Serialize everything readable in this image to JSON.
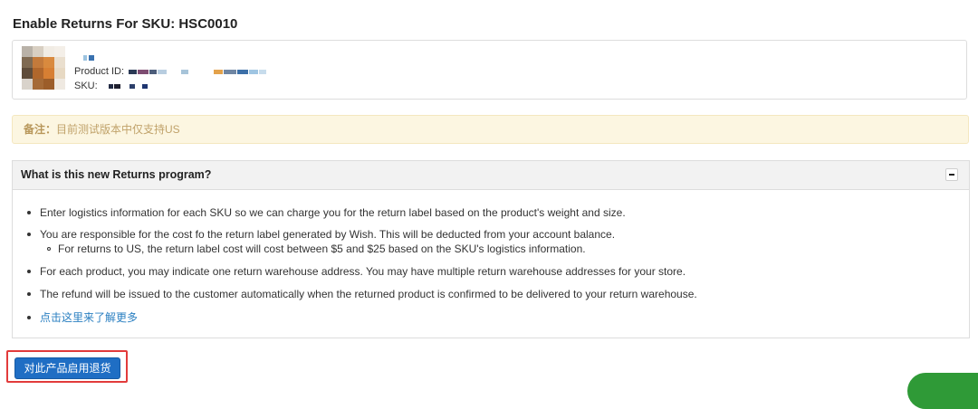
{
  "page": {
    "title": "Enable Returns For SKU: HSC0010"
  },
  "product": {
    "product_id_label": "Product ID:",
    "sku_label": "SKU:"
  },
  "note": {
    "label": "备注：",
    "text": "目前测试版本中仅支持US"
  },
  "returns_program": {
    "title": "What is this new Returns program?",
    "items": [
      "Enter logistics information for each SKU so we can charge you for the return label based on the product's weight and size.",
      "You are responsible for the cost fo the return label generated by Wish. This will be deducted from your account balance.",
      "For each product, you may indicate one return warehouse address. You may have multiple return warehouse addresses for your store.",
      "The refund will be issued to the customer automatically when the returned product is confirmed to be delivered to your return warehouse."
    ],
    "sub_item": "For returns to US, the return label cost will cost between $5 and $25 based on the SKU's logistics information.",
    "learn_more": "点击这里来了解更多"
  },
  "actions": {
    "enable_label": "对此产品启用退货"
  },
  "colors": {
    "accent_button": "#1f6ec4",
    "highlight_frame": "#e23b3b",
    "note_background": "#fcf6e1",
    "link": "#2a7fc1",
    "chat_widget": "#2f9a37"
  },
  "icons": {
    "collapse": "minus-icon"
  }
}
